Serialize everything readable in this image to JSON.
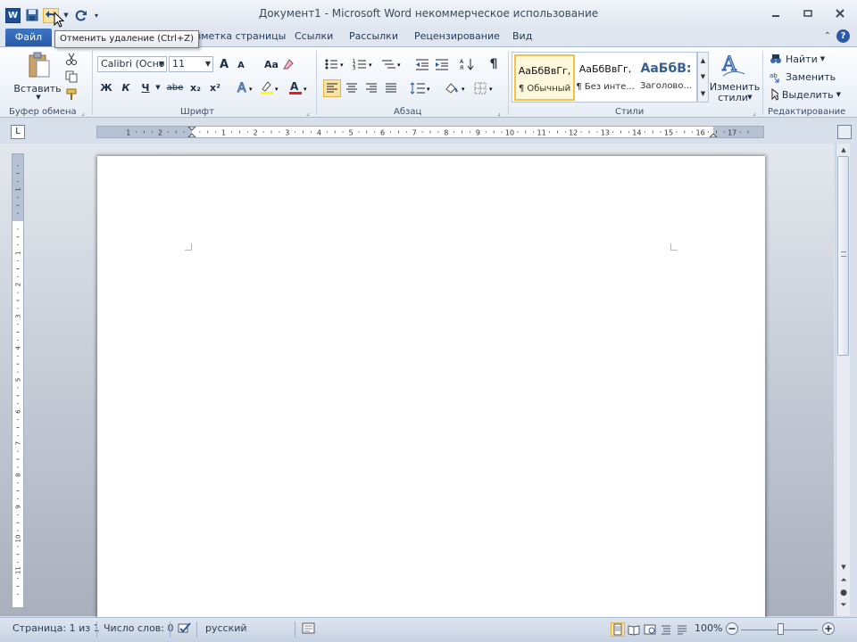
{
  "window": {
    "title": "Документ1  -  Microsoft Word некоммерческое использование"
  },
  "qat": {
    "logo_letter": "W",
    "icons": [
      "save-icon",
      "undo-icon",
      "redo-icon",
      "customize-qat-icon"
    ]
  },
  "tooltip": {
    "text": "Отменить удаление (Ctrl+Z)"
  },
  "tabs": {
    "file": "Файл",
    "page_layout": "Разметка страницы",
    "references": "Ссылки",
    "mailings": "Рассылки",
    "review": "Рецензирование",
    "view": "Вид"
  },
  "ribbon": {
    "clipboard": {
      "paste_label": "Вставить",
      "group_label": "Буфер обмена"
    },
    "font": {
      "font_name": "Calibri (Осно",
      "font_size": "11",
      "group_label": "Шрифт",
      "bold": "Ж",
      "italic": "К",
      "underline": "Ч",
      "strike": "abe",
      "sub": "x₂",
      "sup": "x²",
      "grow": "A",
      "shrink": "A",
      "change_case": "Aa"
    },
    "paragraph": {
      "group_label": "Абзац",
      "pilcrow": "¶"
    },
    "styles": {
      "group_label": "Стили",
      "items": [
        {
          "preview": "АаБбВвГг,",
          "name": "¶ Обычный"
        },
        {
          "preview": "АаБбВвГг,",
          "name": "¶ Без инте..."
        },
        {
          "preview": "АаБбВ:",
          "name": "Заголово..."
        }
      ],
      "change_styles_line1": "Изменить",
      "change_styles_line2": "стили"
    },
    "editing": {
      "group_label": "Редактирование",
      "find": "Найти",
      "replace": "Заменить",
      "select": "Выделить"
    }
  },
  "ruler": {
    "corner": "L",
    "h_numbers": [
      "1",
      "2",
      "1",
      "2",
      "3",
      "4",
      "5",
      "6",
      "7",
      "8",
      "9",
      "10",
      "11",
      "12",
      "13",
      "14",
      "15",
      "16",
      "17"
    ],
    "v_numbers": [
      "2",
      "1",
      "1",
      "2",
      "3",
      "4",
      "5",
      "6",
      "7",
      "8",
      "9",
      "10",
      "11"
    ]
  },
  "status": {
    "page": "Страница: 1 из 1",
    "words": "Число слов: 0",
    "language": "русский",
    "zoom": "100%"
  }
}
